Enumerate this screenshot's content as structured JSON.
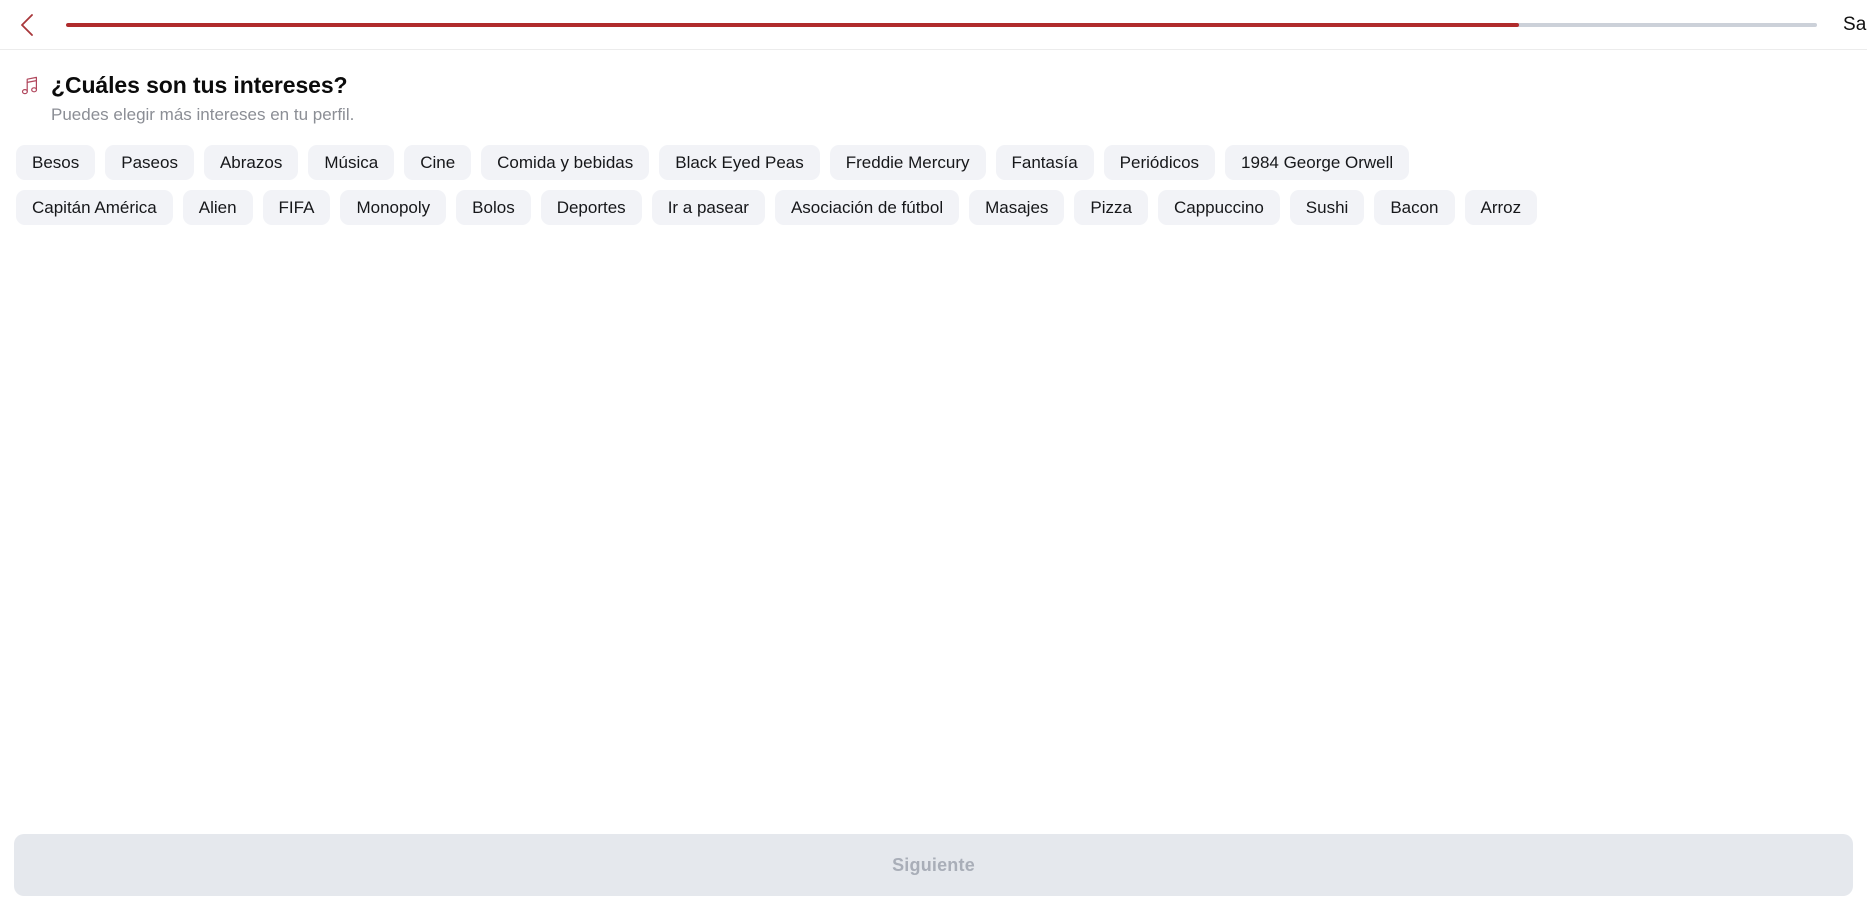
{
  "topbar": {
    "back_icon": "chevron-left-icon",
    "exit_label": "Salir",
    "progress": {
      "percent": 83,
      "fill_color": "#b02b2c",
      "track_color": "#ccd1d9"
    }
  },
  "header": {
    "icon": "music-note-icon",
    "icon_color": "#b02b2c",
    "title": "¿Cuáles son tus intereses?",
    "subtitle": "Puedes elegir más intereses en tu perfil."
  },
  "interests": {
    "chip_background": "#f2f3f7",
    "chip_text_color": "#16171a",
    "items": [
      {
        "label": "Besos",
        "selected": false
      },
      {
        "label": "Paseos",
        "selected": false
      },
      {
        "label": "Abrazos",
        "selected": false
      },
      {
        "label": "Música",
        "selected": false
      },
      {
        "label": "Cine",
        "selected": false
      },
      {
        "label": "Comida y bebidas",
        "selected": false
      },
      {
        "label": "Black Eyed Peas",
        "selected": false
      },
      {
        "label": "Freddie Mercury",
        "selected": false
      },
      {
        "label": "Fantasía",
        "selected": false
      },
      {
        "label": "Periódicos",
        "selected": false
      },
      {
        "label": "1984 George Orwell",
        "selected": false
      },
      {
        "label": "Capitán América",
        "selected": false
      },
      {
        "label": "Alien",
        "selected": false
      },
      {
        "label": "FIFA",
        "selected": false
      },
      {
        "label": "Monopoly",
        "selected": false
      },
      {
        "label": "Bolos",
        "selected": false
      },
      {
        "label": "Deportes",
        "selected": false
      },
      {
        "label": "Ir a pasear",
        "selected": false
      },
      {
        "label": "Asociación de fútbol",
        "selected": false
      },
      {
        "label": "Masajes",
        "selected": false
      },
      {
        "label": "Pizza",
        "selected": false
      },
      {
        "label": "Cappuccino",
        "selected": false
      },
      {
        "label": "Sushi",
        "selected": false
      },
      {
        "label": "Bacon",
        "selected": false
      },
      {
        "label": "Arroz",
        "selected": false
      }
    ]
  },
  "footer": {
    "next_label": "Siguiente",
    "next_enabled": false,
    "next_background": "#e5e8ed",
    "next_text_color": "#a9aeb8"
  }
}
